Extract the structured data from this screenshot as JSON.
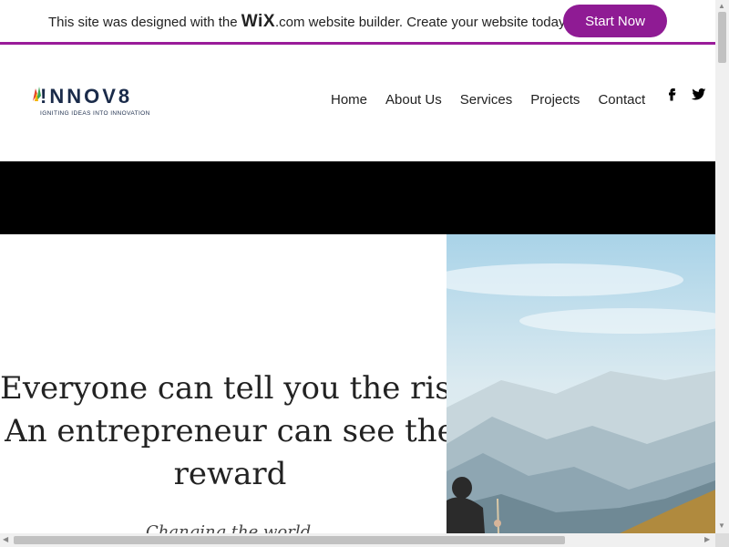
{
  "banner": {
    "text_before": "This site was designed with the ",
    "wix_logo": "WiX",
    "text_after": ".com website builder. Create your website today.",
    "button": "Start Now",
    "accent_color": "#8f1b94"
  },
  "header": {
    "logo_text": "!NNOV8",
    "logo_tagline": "IGNITING IDEAS INTO INNOVATION",
    "nav": [
      "Home",
      "About Us",
      "Services",
      "Projects",
      "Contact"
    ],
    "social": [
      "facebook-icon",
      "twitter-icon"
    ]
  },
  "hero": {
    "quote_lines": [
      "Everyone can tell you the risk.",
      "An entrepreneur can see the",
      "reward"
    ],
    "sub_quote": "Changing the world"
  }
}
